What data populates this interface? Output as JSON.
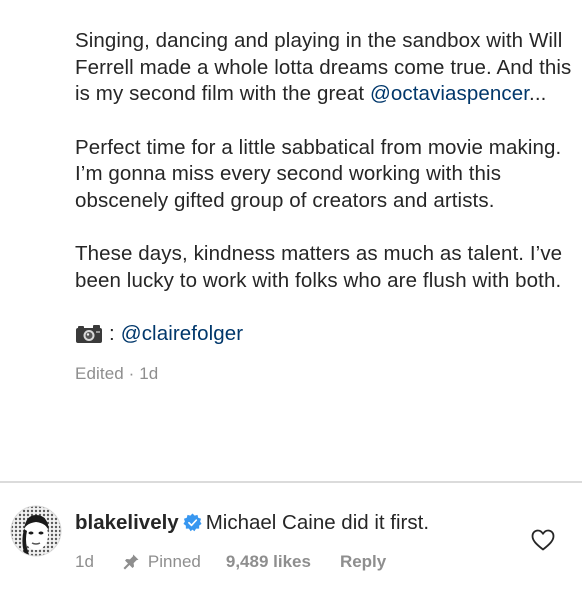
{
  "caption": {
    "para1": "Singing, dancing and playing in the sandbox with Will Ferrell made a whole lotta dreams come true. And this is my second film with the great ",
    "para1_mention": "@octaviaspencer",
    "para1_ellipsis": "...",
    "para2": "Perfect time for a little sabbatical from movie making. I’m gonna miss every second working with this obscenely gifted group of creators and artists.",
    "para3": "These days, kindness matters as much as talent. I’ve been lucky to work with folks who are flush with both.",
    "credit_separator": ":",
    "credit_mention": "@clairefolger",
    "edited_label": "Edited · 1d"
  },
  "comment": {
    "username": "blakelively",
    "text": "Michael Caine did it first.",
    "time": "1d",
    "pinned_label": "Pinned",
    "likes": "9,489 likes",
    "reply_label": "Reply"
  },
  "colors": {
    "text": "#262626",
    "mention": "#00376b",
    "secondary": "#8e8e8e",
    "verified": "#3897f0",
    "divider": "#dbdbdb"
  },
  "icons": {
    "camera": "camera-icon",
    "verified": "verified-badge-icon",
    "pin": "pin-icon",
    "heart": "heart-outline-icon"
  }
}
